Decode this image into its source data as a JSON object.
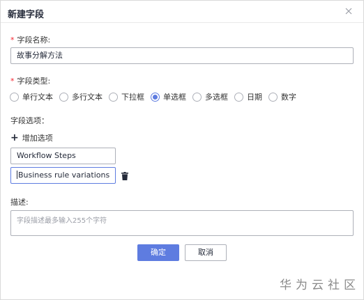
{
  "dialog": {
    "title": "新建字段",
    "close_icon": "close-icon"
  },
  "form": {
    "name_label": "字段名称:",
    "name_required": "*",
    "name_value": "故事分解方法",
    "type_label": "字段类型:",
    "type_required": "*",
    "type_options": [
      "单行文本",
      "多行文本",
      "下拉框",
      "单选框",
      "多选框",
      "日期",
      "数字"
    ],
    "type_selected": "单选框",
    "options_label": "字段选项：",
    "add_option_label": "增加选项",
    "options": [
      "Workflow Steps",
      "Business rule variations"
    ],
    "desc_label": "描述:",
    "desc_placeholder": "字段描述最多输入255个字符"
  },
  "buttons": {
    "confirm": "确定",
    "cancel": "取消"
  },
  "watermark": "华为云社区",
  "colors": {
    "accent": "#5e7ce0",
    "required": "#f5222d"
  }
}
